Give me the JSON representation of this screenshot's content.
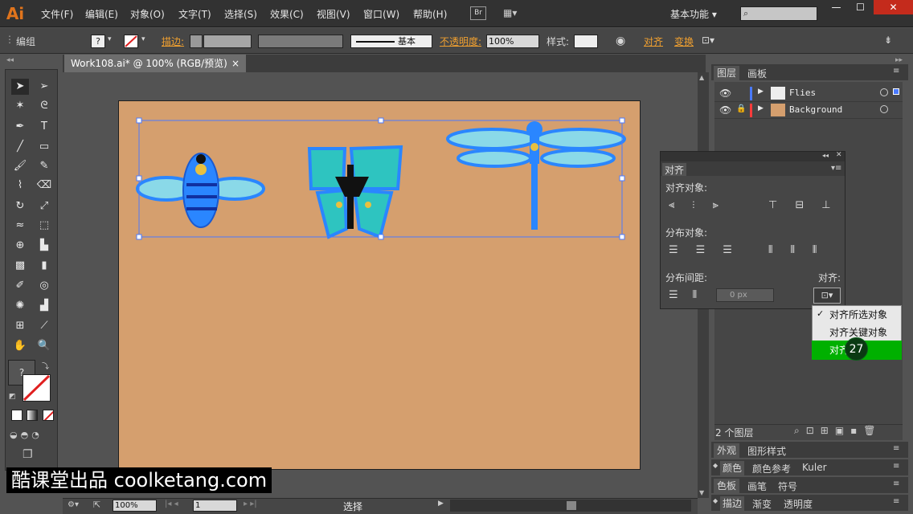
{
  "app": {
    "logo": "Ai"
  },
  "menu": [
    "文件(F)",
    "编辑(E)",
    "对象(O)",
    "文字(T)",
    "选择(S)",
    "效果(C)",
    "视图(V)",
    "窗口(W)",
    "帮助(H)"
  ],
  "bridge": "Br",
  "workspace": "基本功能",
  "window": {
    "minimize": "—",
    "maximize": "☐",
    "close": "✕"
  },
  "control": {
    "group": "编组",
    "stroke_label": "描边:",
    "basic": "基本",
    "opacity_label": "不透明度:",
    "opacity_value": "100%",
    "style_label": "样式:",
    "align_label": "对齐",
    "transform_label": "变换"
  },
  "document": {
    "tab": "Work108.ai* @ 100% (RGB/预览)",
    "close": "×"
  },
  "status": {
    "zoom": "100%",
    "page": "1",
    "mode": "选择"
  },
  "layers": {
    "tabs": [
      "图层",
      "画板"
    ],
    "rows": [
      {
        "name": "Flies",
        "color": "#4a7aff"
      },
      {
        "name": "Background",
        "color": "#ff3b3b"
      }
    ],
    "count": "2 个图层"
  },
  "align_panel": {
    "title": "对齐",
    "align_objects": "对齐对象:",
    "distribute_objects": "分布对象:",
    "distribute_spacing": "分布间距:",
    "align_to": "对齐:",
    "spacing_value": "0 px"
  },
  "align_menu": {
    "items": [
      "对齐所选对象",
      "对齐关键对象",
      "对齐"
    ],
    "badge": "27"
  },
  "bottom_panels": [
    {
      "tabs": [
        "外观",
        "图形样式"
      ]
    },
    {
      "tabs": [
        "颜色",
        "颜色参考",
        "Kuler"
      ]
    },
    {
      "tabs": [
        "色板",
        "画笔",
        "符号"
      ]
    },
    {
      "tabs": [
        "描边",
        "渐变",
        "透明度"
      ]
    }
  ],
  "watermark": "酷课堂出品 coolketang.com",
  "colors": {
    "artboard": "#d59f6e",
    "accent": "#f0a030",
    "highlight": "#00b000",
    "selection": "#4a7aff"
  }
}
